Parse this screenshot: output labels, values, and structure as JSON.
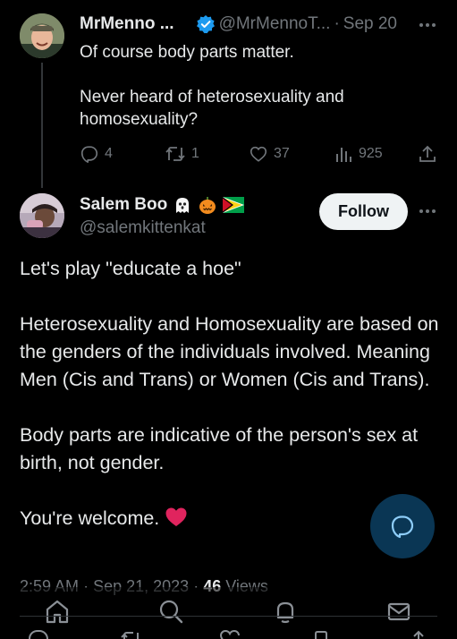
{
  "parent_tweet": {
    "display_name": "MrMenno ...",
    "handle": "@MrMennoT...",
    "date": "Sep 20",
    "text": "Of course body parts matter.\n\nNever heard of heterosexuality and homosexuality?",
    "stats": {
      "replies": "4",
      "retweets": "1",
      "likes": "37",
      "views": "925"
    }
  },
  "main_tweet": {
    "display_name": "Salem Boo",
    "handle": "@salemkittenkat",
    "follow_label": "Follow",
    "text": "Let's play \"educate a hoe\"\n\nHeterosexuality and Homosexuality are based on the genders of the individuals involved. Meaning Men (Cis and Trans) or Women (Cis and Trans).\n\nBody parts are indicative of the person's sex at birth, not gender.\n\nYou're welcome.",
    "time": "2:59 AM",
    "date": "Sep 21, 2023",
    "views_count": "46",
    "views_label": "Views"
  },
  "icons": {
    "verified": "verified-badge-icon",
    "more": "more-dots-icon",
    "reply": "reply-icon",
    "retweet": "retweet-icon",
    "like": "like-icon",
    "views": "views-icon",
    "share": "share-icon",
    "compose": "compose-icon",
    "nav": [
      "home-icon",
      "search-icon",
      "notifications-icon",
      "messages-icon"
    ]
  },
  "colors": {
    "background": "#000000",
    "text": "#e7e9ea",
    "muted": "#71767b",
    "verified": "#1d9bf0",
    "follow_bg": "#eff3f4",
    "heart": "#f91880"
  }
}
